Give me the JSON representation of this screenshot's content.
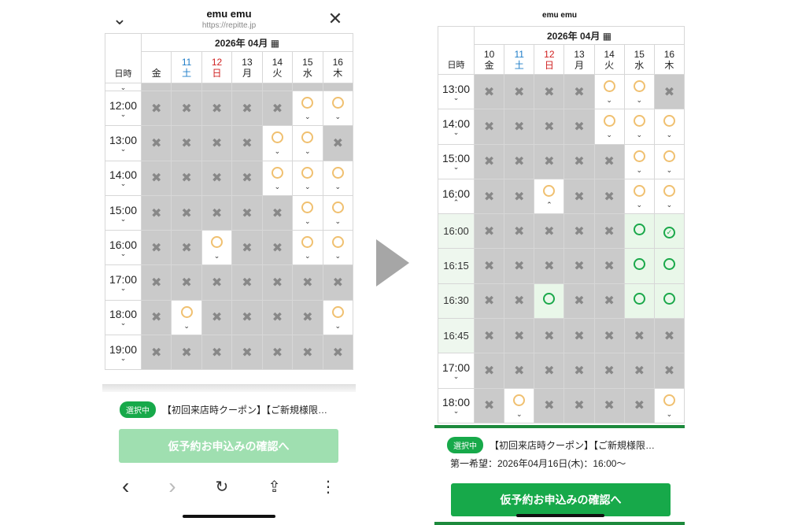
{
  "left": {
    "site_title": "emu emu",
    "site_url": "https://repitte.jp",
    "month_label": "2026年 04月",
    "corner_label": "日時",
    "days": [
      {
        "num": "",
        "wd": "金",
        "cls": ""
      },
      {
        "num": "11",
        "wd": "土",
        "cls": "sat"
      },
      {
        "num": "12",
        "wd": "日",
        "cls": "sun"
      },
      {
        "num": "13",
        "wd": "月",
        "cls": ""
      },
      {
        "num": "14",
        "wd": "火",
        "cls": ""
      },
      {
        "num": "15",
        "wd": "水",
        "cls": ""
      },
      {
        "num": "16",
        "wd": "木",
        "cls": ""
      }
    ],
    "rows": [
      {
        "time": "12:00",
        "slots": [
          "x",
          "x",
          "x",
          "x",
          "x",
          "o",
          "o"
        ]
      },
      {
        "time": "13:00",
        "slots": [
          "x",
          "x",
          "x",
          "x",
          "o",
          "o",
          "x"
        ]
      },
      {
        "time": "14:00",
        "slots": [
          "x",
          "x",
          "x",
          "x",
          "o",
          "o",
          "o"
        ]
      },
      {
        "time": "15:00",
        "slots": [
          "x",
          "x",
          "x",
          "x",
          "x",
          "o",
          "o"
        ]
      },
      {
        "time": "16:00",
        "slots": [
          "x",
          "x",
          "o",
          "x",
          "x",
          "o",
          "o"
        ]
      },
      {
        "time": "17:00",
        "slots": [
          "x",
          "x",
          "x",
          "x",
          "x",
          "x",
          "x"
        ]
      },
      {
        "time": "18:00",
        "slots": [
          "x",
          "o",
          "x",
          "x",
          "x",
          "x",
          "o"
        ]
      },
      {
        "time": "19:00",
        "slots": [
          "x",
          "x",
          "x",
          "x",
          "x",
          "x",
          "x"
        ]
      }
    ],
    "selected_badge": "選択中",
    "selected_text": "【初回来店時クーポン】【ご新規様限…",
    "confirm_button": "仮予約お申込みの確認へ",
    "nav": {
      "back": "‹",
      "forward": "›",
      "reload": "↻",
      "share": "⇪",
      "more": "⋮"
    }
  },
  "right": {
    "site_title": "emu emu",
    "month_label": "2026年 04月",
    "corner_label": "日時",
    "days": [
      {
        "num": "10",
        "wd": "金",
        "cls": ""
      },
      {
        "num": "11",
        "wd": "土",
        "cls": "sat"
      },
      {
        "num": "12",
        "wd": "日",
        "cls": "sun"
      },
      {
        "num": "13",
        "wd": "月",
        "cls": ""
      },
      {
        "num": "14",
        "wd": "火",
        "cls": ""
      },
      {
        "num": "15",
        "wd": "水",
        "cls": ""
      },
      {
        "num": "16",
        "wd": "木",
        "cls": ""
      }
    ],
    "rows": [
      {
        "time": "13:00",
        "q": false,
        "chev": "down",
        "slots": [
          "x",
          "x",
          "x",
          "x",
          "o",
          "o",
          "x"
        ]
      },
      {
        "time": "14:00",
        "q": false,
        "chev": "down",
        "slots": [
          "x",
          "x",
          "x",
          "x",
          "o",
          "o",
          "o"
        ]
      },
      {
        "time": "15:00",
        "q": false,
        "chev": "down",
        "slots": [
          "x",
          "x",
          "x",
          "x",
          "x",
          "o",
          "o"
        ]
      },
      {
        "time": "16:00",
        "q": false,
        "chev": "up",
        "slots": [
          "x",
          "x",
          "ou",
          "x",
          "x",
          "o",
          "o"
        ]
      },
      {
        "time": "16:00",
        "q": true,
        "chev": "",
        "slots": [
          "x",
          "x",
          "x",
          "x",
          "x",
          "g",
          "gc"
        ]
      },
      {
        "time": "16:15",
        "q": true,
        "chev": "",
        "slots": [
          "x",
          "x",
          "x",
          "x",
          "x",
          "g",
          "g"
        ]
      },
      {
        "time": "16:30",
        "q": true,
        "chev": "",
        "slots": [
          "x",
          "x",
          "g",
          "x",
          "x",
          "g",
          "g"
        ]
      },
      {
        "time": "16:45",
        "q": true,
        "chev": "",
        "slots": [
          "x",
          "x",
          "x",
          "x",
          "x",
          "x",
          "x"
        ]
      },
      {
        "time": "17:00",
        "q": false,
        "chev": "down",
        "slots": [
          "x",
          "x",
          "x",
          "x",
          "x",
          "x",
          "x"
        ]
      },
      {
        "time": "18:00",
        "q": false,
        "chev": "down",
        "slots": [
          "x",
          "o",
          "x",
          "x",
          "x",
          "x",
          "o"
        ]
      }
    ],
    "selected_badge": "選択中",
    "selected_text": "【初回来店時クーポン】【ご新規様限…",
    "first_choice": "第一希望：2026年04月16日(木)：16:00〜",
    "confirm_button": "仮予約お申込みの確認へ"
  },
  "colors": {
    "accent_green": "#17a94a",
    "highlight_border": "#1d8a3c",
    "disabled_button": "#9fdfb0",
    "unavailable": "#cacaca",
    "available_ring": "#f0c070"
  }
}
